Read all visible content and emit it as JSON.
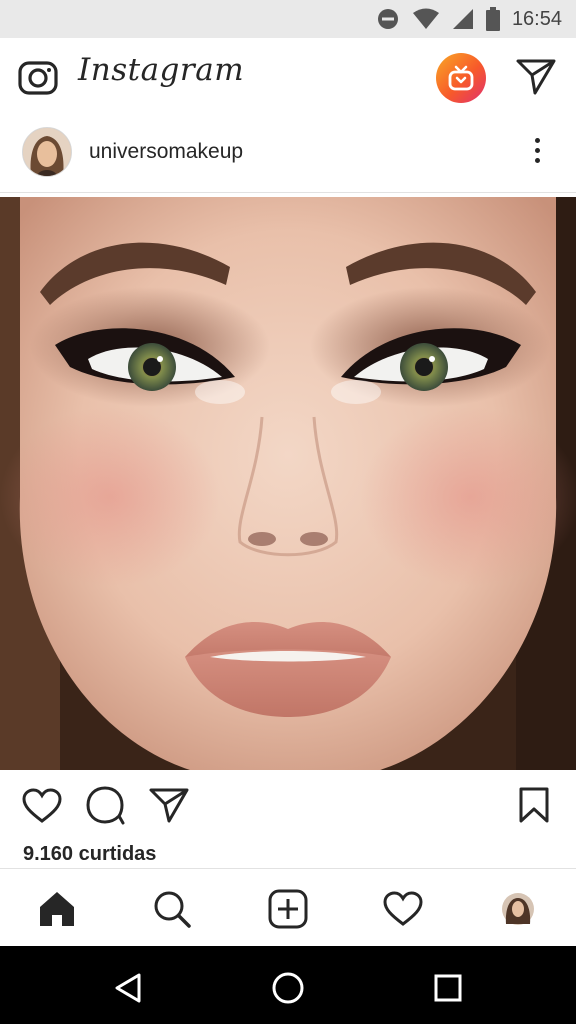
{
  "status_bar": {
    "time": "16:54",
    "icons": [
      "do-not-disturb-icon",
      "wifi-icon",
      "signal-icon",
      "battery-icon"
    ]
  },
  "app_header": {
    "title": "Instagram",
    "left_icon": "camera-icon",
    "igtv_icon": "igtv-icon",
    "right_icon": "direct-message-icon",
    "igtv_gradient": [
      "#f9a826",
      "#f75a2a",
      "#e0306f"
    ]
  },
  "post": {
    "username": "universomakeup",
    "avatar_icon": "avatar",
    "menu_icon": "more-options-icon",
    "image_subject": "close-up face with smoky eye makeup",
    "actions": [
      "like-icon",
      "comment-icon",
      "share-icon",
      "save-icon"
    ],
    "likes_text": "9.160 curtidas"
  },
  "bottom_nav": {
    "items": [
      "home-icon",
      "search-icon",
      "add-post-icon",
      "activity-icon",
      "profile-avatar"
    ],
    "active": "home-icon"
  },
  "system_nav": {
    "items": [
      "back-icon",
      "home-circle-icon",
      "recents-icon"
    ]
  },
  "colors": {
    "text": "#262626",
    "status_bg": "#e9e9e9",
    "divider": "#e2e2e2",
    "system_nav_bg": "#000000"
  }
}
